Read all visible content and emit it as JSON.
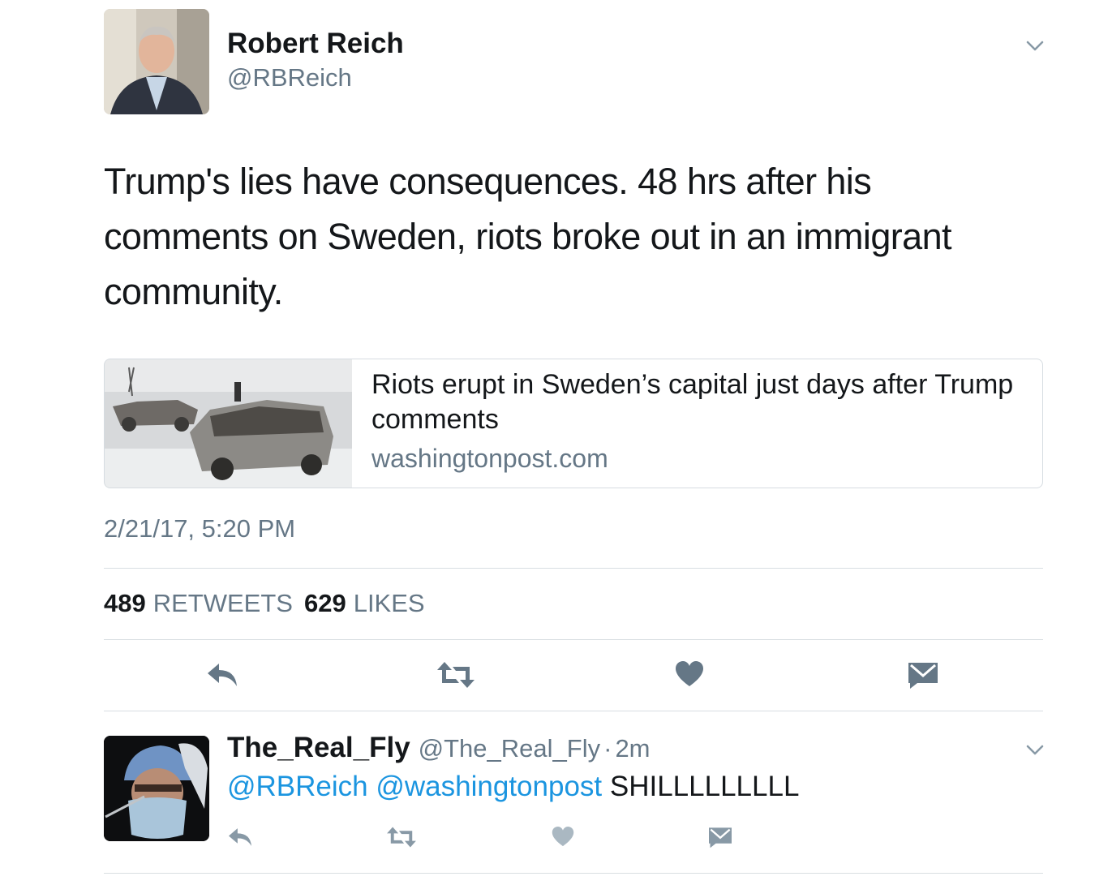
{
  "tweet": {
    "author": {
      "name": "Robert Reich",
      "handle": "@RBReich",
      "avatar_icon": "profile-photo"
    },
    "text": "Trump's lies have consequences. 48 hrs after his comments on Sweden, riots broke out in an immigrant community.",
    "card": {
      "title": "Riots erupt in Sweden’s capital just days after Trump comments",
      "domain": "washingtonpost.com",
      "image_icon": "burned-cars-photo"
    },
    "timestamp": "2/21/17, 5:20 PM",
    "stats": {
      "retweets_count": "489",
      "retweets_label": "RETWEETS",
      "likes_count": "629",
      "likes_label": "LIKES"
    },
    "actions": [
      {
        "name": "reply",
        "icon": "reply-icon"
      },
      {
        "name": "retweet",
        "icon": "retweet-icon"
      },
      {
        "name": "like",
        "icon": "heart-icon"
      },
      {
        "name": "message",
        "icon": "direct-message-icon"
      }
    ]
  },
  "reply": {
    "author_name": "The_Real_Fly",
    "author_handle": "@The_Real_Fly",
    "separator": "·",
    "time": "2m",
    "mentions": [
      "@RBReich",
      "@washingtonpost"
    ],
    "text": "SHILLLLLLLLL",
    "avatar_icon": "profile-photo"
  },
  "colors": {
    "text": "#14171a",
    "secondary": "#657786",
    "link": "#1b95e0",
    "icon": "#657786",
    "divider": "#d9dee2"
  }
}
